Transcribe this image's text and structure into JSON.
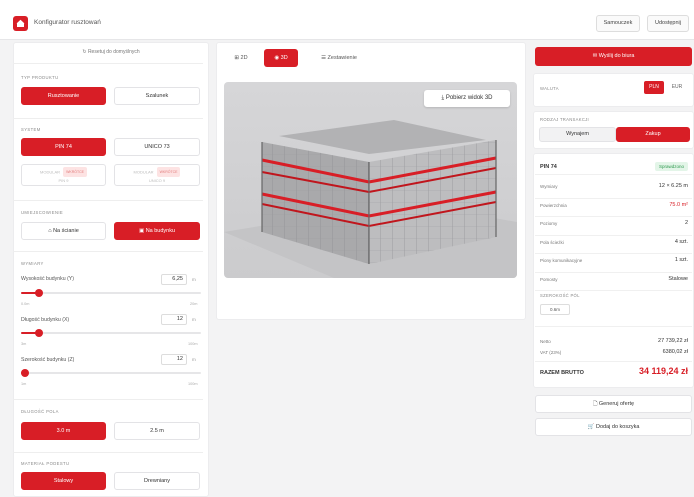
{
  "app": {
    "title": "Konfigurator rusztowań",
    "brand_color": "#d81e26",
    "buttons": {
      "guide": "Samouczek",
      "share": "Udostępnij"
    }
  },
  "left_panel": {
    "reset_label": "Resetuj do domyślnych",
    "product_type": {
      "label": "TYP PRODUKTU",
      "options": [
        "Rusztowanie",
        "Szalunek"
      ],
      "selected": "Rusztowanie"
    },
    "system": {
      "label": "SYSTEM",
      "options": [
        "PIN 74",
        "UNICO 73"
      ],
      "selected": "PIN 74",
      "disabled_options": [
        {
          "name": "MODULAR",
          "sub": "PIN 9",
          "badge": "WKRÓTCE"
        },
        {
          "name": "MODULAR",
          "sub": "UNICO 9",
          "badge": "WKRÓTCE"
        }
      ]
    },
    "placement": {
      "label": "UMIEJSCOWIENIE",
      "options": [
        "Na ścianie",
        "Na budynku"
      ],
      "selected": "Na budynku"
    },
    "dimensions": {
      "label": "WYMIARY",
      "unit": "m",
      "items": [
        {
          "label": "Wysokość budynku (Y)",
          "value": "6,25",
          "min": "0.0m",
          "max": "20m",
          "fraction": 0.1
        },
        {
          "label": "Długość budynku (X)",
          "value": "12",
          "min": "3m",
          "max": "100m",
          "fraction": 0.1
        },
        {
          "label": "Szerokość budynku (Z)",
          "value": "12",
          "min": "1m",
          "max": "100m",
          "fraction": 0.02
        }
      ]
    },
    "field_length": {
      "label": "DŁUGOŚĆ POLA",
      "options": [
        "3.0 m",
        "2.5 m"
      ],
      "selected": "3.0 m"
    },
    "platform_material": {
      "label": "MATERIAŁ PODESTU",
      "options": [
        "Stalowy",
        "Drewniany"
      ],
      "selected": "Stalowy"
    }
  },
  "viewer": {
    "tabs": [
      "2D",
      "3D",
      "Zestawienie"
    ],
    "active_tab": "3D",
    "download_label": "Pobierz widok 3D"
  },
  "right_panel": {
    "send_label": "Wyślij do biura",
    "currency": {
      "label": "WALUTA",
      "options": [
        "PLN",
        "EUR"
      ],
      "selected": "PLN"
    },
    "transaction": {
      "label": "RODZAJ TRANSAKCJI",
      "options": [
        "Wynajem",
        "Zakup"
      ],
      "selected": "Zakup"
    },
    "summary": {
      "system": "PIN 74",
      "status": "Sprawdzono",
      "rows": [
        {
          "label": "Wymiary",
          "value": "12 × 6.25 m"
        },
        {
          "label": "Powierzchnia",
          "value": "75.0 m²",
          "accent": true
        },
        {
          "label": "Poziomy",
          "value": "2"
        },
        {
          "label": "Pola ścieżki",
          "value": "4 szt."
        },
        {
          "label": "Piony komunikacyjne",
          "value": "1 szt."
        },
        {
          "label": "Pomosty",
          "value": "Stalowe"
        }
      ],
      "field_width_label": "SZEROKOŚĆ PÓL",
      "field_width_value": "0.6m"
    },
    "totals": {
      "net_label": "Netto",
      "net_value": "27 739,22 zł",
      "vat_label": "VAT (23%)",
      "vat_value": "6380,02 zł",
      "gross_label": "RAZEM BRUTTO",
      "gross_value": "34 119,24 zł"
    },
    "actions": {
      "offer": "Generuj ofertę",
      "cart": "Dodaj do koszyka"
    }
  }
}
